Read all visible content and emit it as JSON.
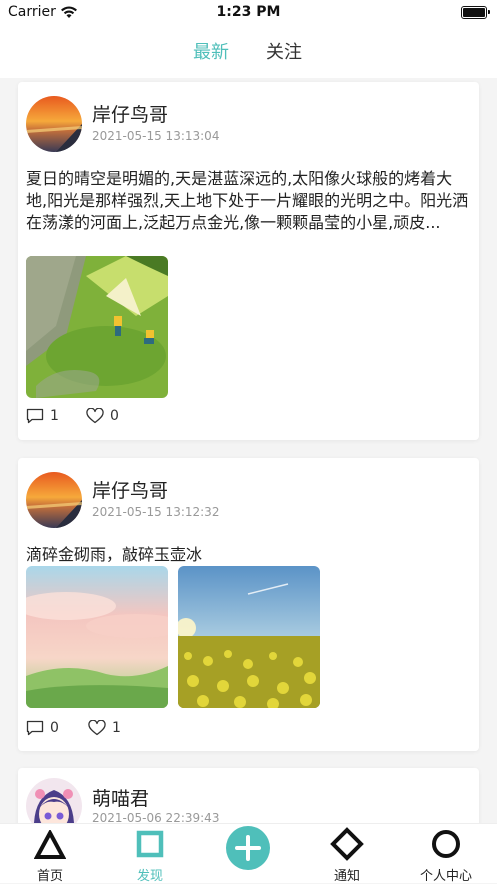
{
  "status_bar": {
    "carrier": "Carrier",
    "time": "1:23 PM"
  },
  "tabs": {
    "latest": "最新",
    "follow": "关注"
  },
  "posts": [
    {
      "author": "岸仔鸟哥",
      "date": "2021-05-15 13:13:04",
      "text": "夏日的晴空是明媚的,天是湛蓝深远的,太阳像火球般的烤着大地,阳光是那样强烈,天上地下处于一片耀眼的光明之中。阳光洒在荡漾的河面上,泛起万点金光,像一颗颗晶莹的小星,顽皮...",
      "comments": "1",
      "likes": "0"
    },
    {
      "author": "岸仔鸟哥",
      "date": "2021-05-15 13:12:32",
      "text": "滴碎金砌雨，敲碎玉壶冰",
      "comments": "0",
      "likes": "1"
    },
    {
      "author": "萌喵君",
      "date": "2021-05-06 22:39:43"
    }
  ],
  "tabbar": {
    "home": "首页",
    "discover": "发现",
    "notify": "通知",
    "profile": "个人中心"
  },
  "colors": {
    "accent": "#4fbfba"
  }
}
